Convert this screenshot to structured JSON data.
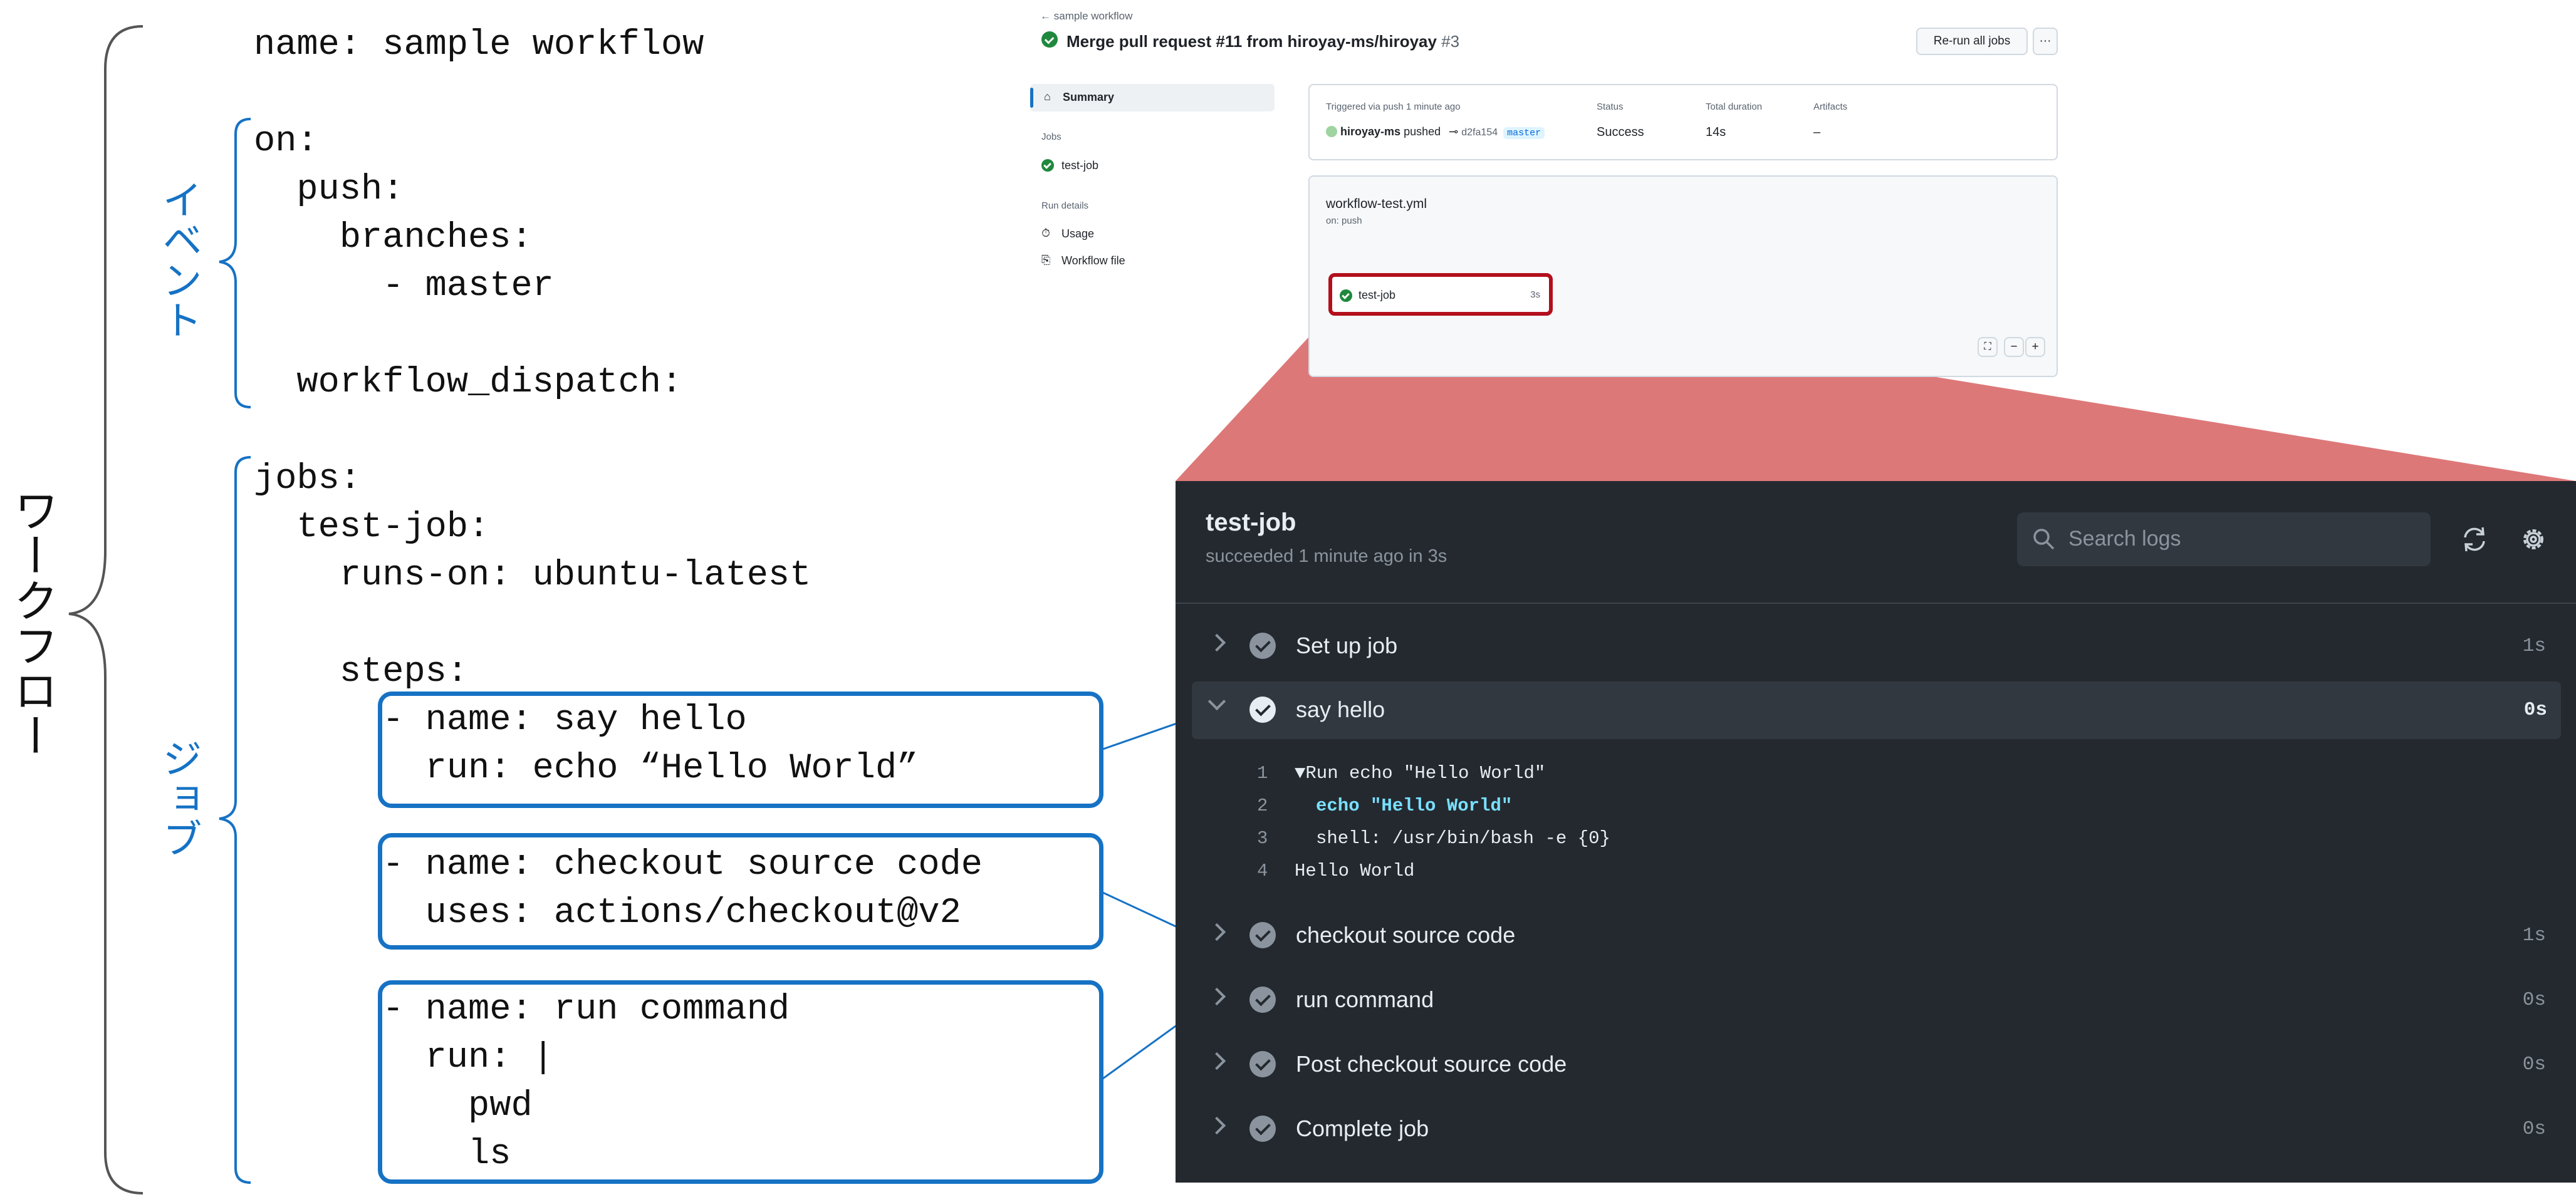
{
  "yaml": {
    "lines": [
      "name: sample workflow",
      "on:",
      "  push:",
      "    branches:",
      "      - master",
      "  workflow_dispatch:",
      "jobs:",
      "  test-job:",
      "    runs-on: ubuntu-latest",
      "    steps:",
      "      - name: say hello",
      "        run: echo “Hello World”",
      "      - name: checkout source code",
      "        uses: actions/checkout@v2",
      "      - name: run command",
      "        run: |",
      "          pwd",
      "          ls"
    ]
  },
  "labels": {
    "workflow": "ワークフロー",
    "event": "イベント",
    "job": "ジョブ"
  },
  "colors": {
    "accent_blue": "#1672c4",
    "highlight_red": "#b30f1c",
    "callout_fill": "#d65a5c",
    "success_green": "#1f883d"
  },
  "summary": {
    "back_link": "sample workflow",
    "title": "Merge pull request #11 from hiroyay-ms/hiroyay",
    "run_number": "#3",
    "rerun_button": "Re-run all jobs",
    "more_button": "···",
    "nav_summary": "Summary",
    "nav_jobs_heading": "Jobs",
    "nav_job": "test-job",
    "nav_run_details_heading": "Run details",
    "nav_usage": "Usage",
    "nav_workflow_file": "Workflow file",
    "trigger_label": "Triggered via push 1 minute ago",
    "actor": "hiroyay-ms",
    "actor_action": "pushed",
    "commit": "d2fa154",
    "branch": "master",
    "status_label": "Status",
    "status_value": "Success",
    "duration_label": "Total duration",
    "duration_value": "14s",
    "artifacts_label": "Artifacts",
    "artifacts_value": "–",
    "workflow_file": "workflow-test.yml",
    "workflow_trigger": "on: push",
    "graph_job": "test-job",
    "graph_job_duration": "3s",
    "zoom_minus": "−",
    "zoom_plus": "+"
  },
  "log": {
    "job_title": "test-job",
    "job_status": "succeeded 1 minute ago in 3s",
    "search_placeholder": "Search logs",
    "steps": [
      {
        "label": "Set up job",
        "duration": "1s"
      },
      {
        "label": "say hello",
        "duration": "0s"
      },
      {
        "label": "checkout source code",
        "duration": "1s"
      },
      {
        "label": "run command",
        "duration": "0s"
      },
      {
        "label": "Post checkout source code",
        "duration": "0s"
      },
      {
        "label": "Complete job",
        "duration": "0s"
      }
    ],
    "output": [
      {
        "num": "1",
        "text": "▼Run echo \"Hello World\""
      },
      {
        "num": "2",
        "text": "echo \"Hello World\""
      },
      {
        "num": "3",
        "text": "shell: /usr/bin/bash -e {0}"
      },
      {
        "num": "4",
        "text": "Hello World"
      }
    ]
  }
}
